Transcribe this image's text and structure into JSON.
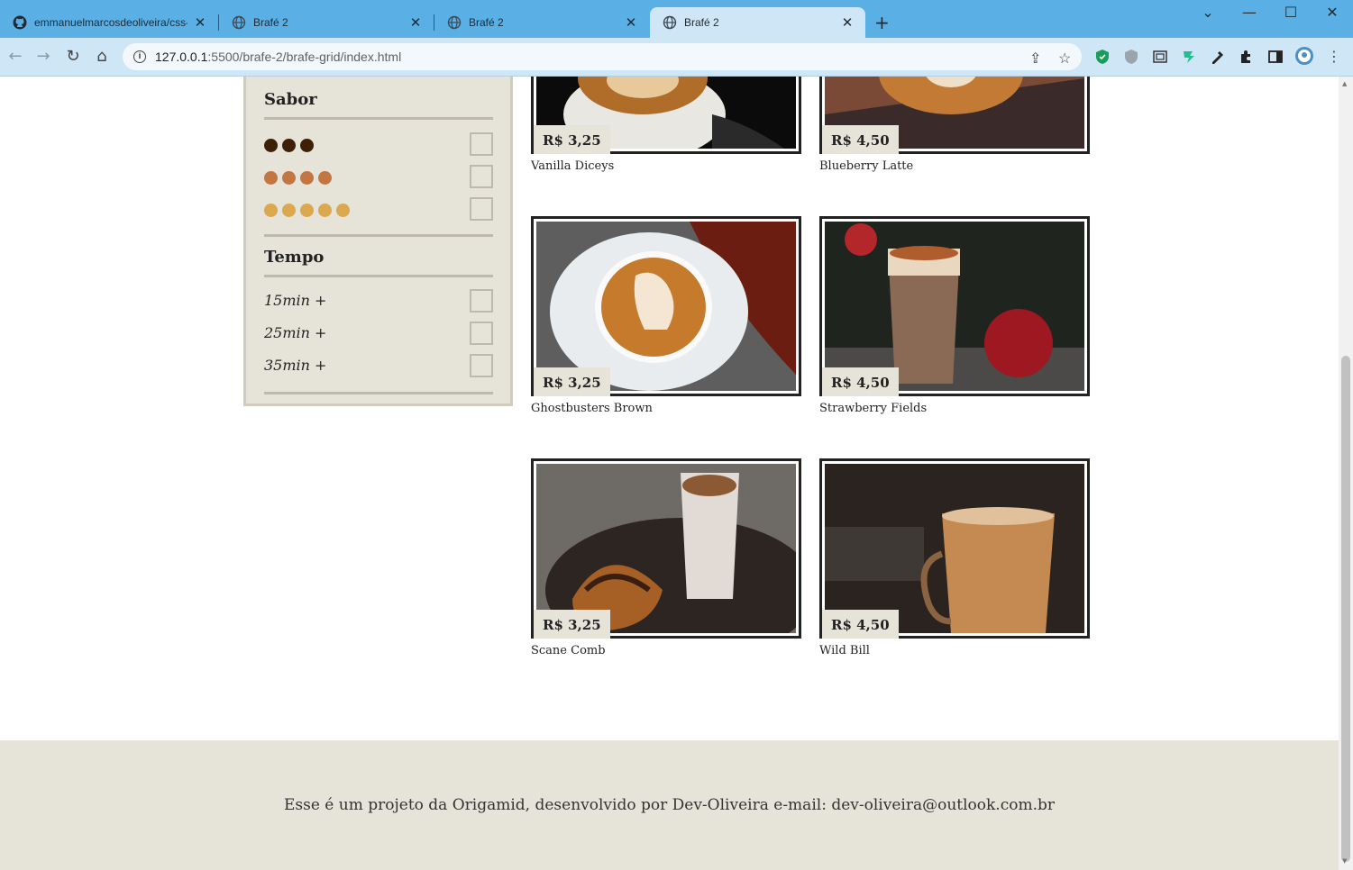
{
  "browser": {
    "tabs": [
      {
        "title": "emmanuelmarcosdeoliveira/css-a",
        "icon": "github-icon",
        "active": false
      },
      {
        "title": "Brafé 2",
        "icon": "globe-icon",
        "active": false
      },
      {
        "title": "Brafé 2",
        "icon": "globe-icon",
        "active": false
      },
      {
        "title": "Brafé 2",
        "icon": "globe-icon",
        "active": true
      }
    ],
    "url_host": "127.0.0.1",
    "url_path": ":5500/brafe-2/brafe-grid/index.html",
    "new_tab": "+",
    "window_controls": [
      "⌄",
      "—",
      "☐",
      "✕"
    ]
  },
  "filters": {
    "sabor_title": "Sabor",
    "sabor": [
      {
        "dots": 3,
        "color": "#3d2106"
      },
      {
        "dots": 4,
        "color": "#c47642"
      },
      {
        "dots": 5,
        "color": "#dca84d"
      }
    ],
    "tempo_title": "Tempo",
    "tempo": [
      "15min +",
      "25min +",
      "35min +"
    ]
  },
  "products": [
    {
      "name": "Vanilla Diceys",
      "price": "R$ 3,25"
    },
    {
      "name": "Blueberry Latte",
      "price": "R$ 4,50"
    },
    {
      "name": "Ghostbusters Brown",
      "price": "R$ 3,25"
    },
    {
      "name": "Strawberry Fields",
      "price": "R$ 4,50"
    },
    {
      "name": "Scane Comb",
      "price": "R$ 3,25"
    },
    {
      "name": "Wild Bill",
      "price": "R$ 4,50"
    }
  ],
  "footer": {
    "text": "Esse é um projeto da Origamid, desenvolvido por Dev-Oliveira e-mail: dev-oliveira@outlook.com.br"
  }
}
